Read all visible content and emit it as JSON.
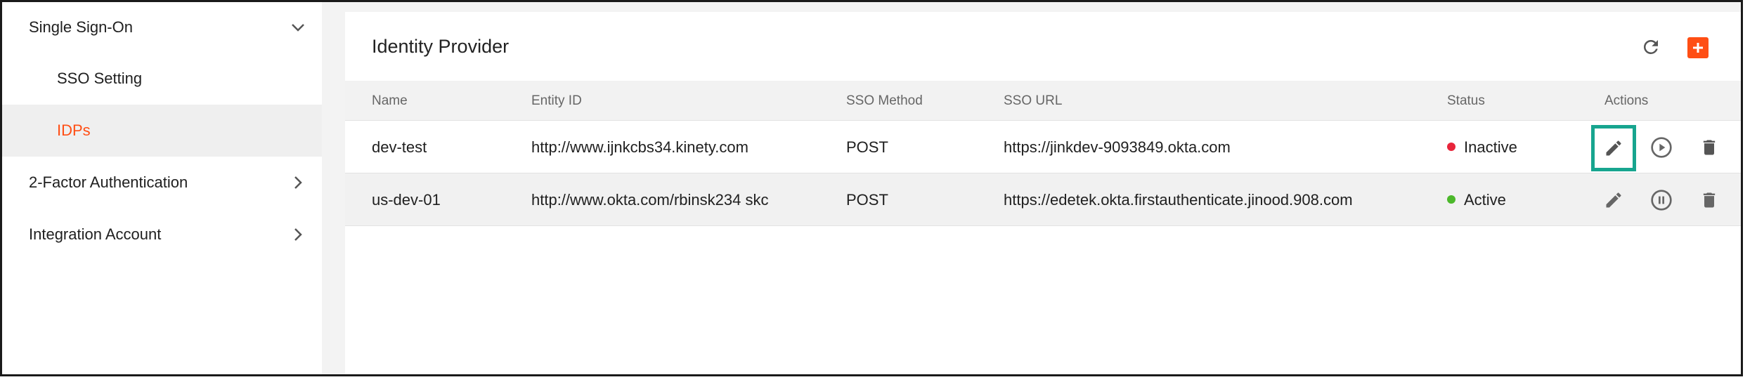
{
  "sidebar": {
    "items": [
      {
        "label": "Single Sign-On",
        "chevron": "chevron-down-icon"
      },
      {
        "label": "SSO Setting"
      },
      {
        "label": "IDPs",
        "active": true
      },
      {
        "label": "2-Factor Authentication",
        "chevron": "chevron-right-icon"
      },
      {
        "label": "Integration Account",
        "chevron": "chevron-right-icon"
      }
    ]
  },
  "card": {
    "title": "Identity Provider",
    "refresh_icon": "refresh-icon",
    "add_icon": "plus-icon"
  },
  "table": {
    "columns": [
      "Name",
      "Entity ID",
      "SSO Method",
      "SSO URL",
      "Status",
      "Actions"
    ],
    "rows": [
      {
        "name": "dev-test",
        "entity_id": "http://www.ijnkcbs34.kinety.com",
        "method": "POST",
        "url": "https://jinkdev-9093849.okta.com",
        "status": "Inactive",
        "status_color": "#e8253b",
        "toggle_icon": "play-circle-icon"
      },
      {
        "name": "us-dev-01",
        "entity_id": "http://www.okta.com/rbinsk234 skc",
        "method": "POST",
        "url": "https://edetek.okta.firstauthenticate.jinood.908.com",
        "status": "Active",
        "status_color": "#4cb82b",
        "toggle_icon": "pause-circle-icon"
      }
    ]
  },
  "colors": {
    "accent": "#ff4e14",
    "highlight": "#17a58f"
  }
}
